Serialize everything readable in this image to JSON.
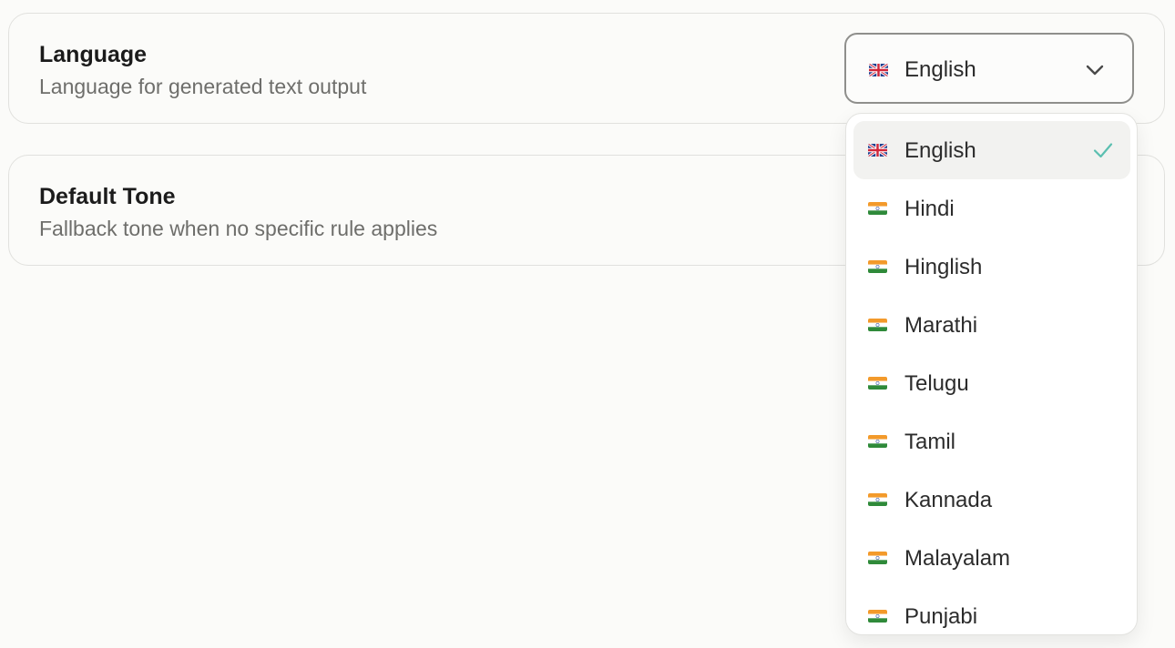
{
  "language_setting": {
    "title": "Language",
    "description": "Language for generated text output",
    "selected_value": "English",
    "selected_flag": "uk-flag-icon"
  },
  "tone_setting": {
    "title": "Default Tone",
    "description": "Fallback tone when no specific rule applies"
  },
  "dropdown": {
    "options": [
      {
        "label": "English",
        "flag": "uk-flag-icon",
        "selected": true
      },
      {
        "label": "Hindi",
        "flag": "india-flag-icon",
        "selected": false
      },
      {
        "label": "Hinglish",
        "flag": "india-flag-icon",
        "selected": false
      },
      {
        "label": "Marathi",
        "flag": "india-flag-icon",
        "selected": false
      },
      {
        "label": "Telugu",
        "flag": "india-flag-icon",
        "selected": false
      },
      {
        "label": "Tamil",
        "flag": "india-flag-icon",
        "selected": false
      },
      {
        "label": "Kannada",
        "flag": "india-flag-icon",
        "selected": false
      },
      {
        "label": "Malayalam",
        "flag": "india-flag-icon",
        "selected": false
      },
      {
        "label": "Punjabi",
        "flag": "india-flag-icon",
        "selected": false
      }
    ]
  },
  "colors": {
    "check_accent": "#5bbfb0",
    "selected_option_bg": "#f2f2f0"
  }
}
